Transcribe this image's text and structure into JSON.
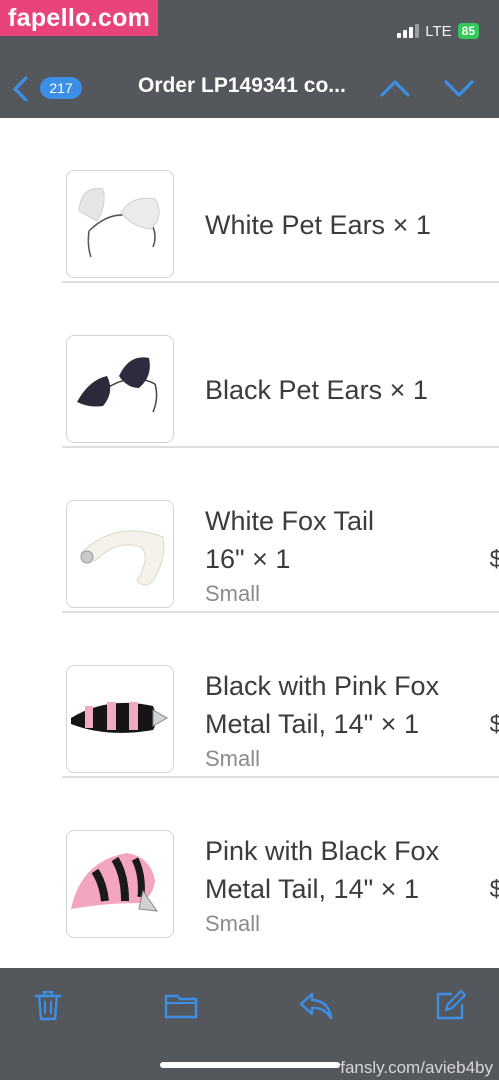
{
  "watermark_top": "fapello.com",
  "watermark_bottom": "fansly.com/avieb4by",
  "status_bar": {
    "network": "LTE",
    "battery": "85"
  },
  "nav": {
    "unread_count": "217",
    "title": "Order LP149341 co..."
  },
  "items": [
    {
      "name": "White Pet Ears × 1",
      "variant": "",
      "thumb": "white-ears"
    },
    {
      "name": "Black Pet Ears × 1",
      "variant": "",
      "thumb": "black-ears"
    },
    {
      "name": "White Fox Tail\n16\" × 1",
      "variant": "Small",
      "thumb": "white-tail",
      "price_edge": "$"
    },
    {
      "name": "Black with Pink Fox\nMetal Tail, 14\" × 1",
      "variant": "Small",
      "thumb": "black-pink-tail",
      "price_edge": "$"
    },
    {
      "name": "Pink with Black Fox\nMetal Tail, 14\" × 1",
      "variant": "Small",
      "thumb": "pink-black-tail",
      "price_edge": "$"
    }
  ],
  "toolbar": {
    "icons": [
      "trash-icon",
      "folder-icon",
      "reply-icon",
      "compose-icon"
    ]
  },
  "colors": {
    "bar": "#54585c",
    "accent": "#3b8fe6",
    "battery": "#34c759",
    "watermark": "#e8437a"
  }
}
